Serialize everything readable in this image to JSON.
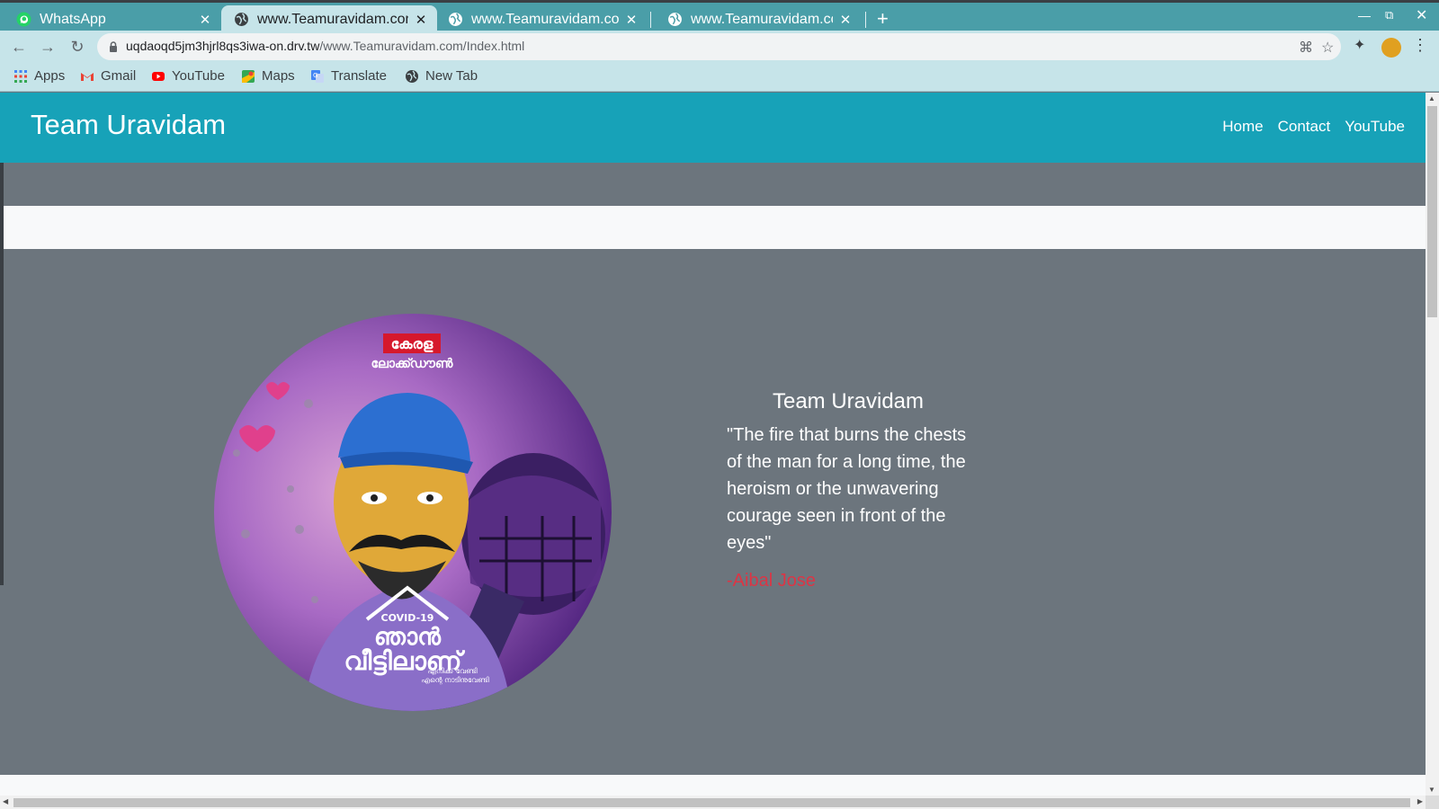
{
  "browser": {
    "tabs": [
      {
        "title": "WhatsApp",
        "icon": "whatsapp-icon",
        "active": false
      },
      {
        "title": "www.Teamuravidam.com",
        "icon": "globe-icon",
        "active": true
      },
      {
        "title": "www.Teamuravidam.com",
        "icon": "globe-icon",
        "active": false
      },
      {
        "title": "www.Teamuravidam.com",
        "icon": "globe-icon",
        "active": false
      }
    ],
    "url_host": "uqdaoqd5jm3hjrl8qs3iwa-on.drv.tw",
    "url_path": "/www.Teamuravidam.com/Index.html",
    "bookmarks": [
      {
        "label": "Apps",
        "icon": "apps-grid-icon"
      },
      {
        "label": "Gmail",
        "icon": "gmail-icon"
      },
      {
        "label": "YouTube",
        "icon": "youtube-icon"
      },
      {
        "label": "Maps",
        "icon": "maps-icon"
      },
      {
        "label": "Translate",
        "icon": "translate-icon"
      },
      {
        "label": "New Tab",
        "icon": "globe-icon"
      }
    ]
  },
  "site": {
    "brand": "Team Uravidam",
    "nav": [
      "Home",
      "Contact",
      "YouTube"
    ],
    "colors": {
      "navbar": "#17a2b8",
      "body": "#6c757d",
      "author": "#dc3545"
    }
  },
  "hero": {
    "image_text_top_1": "കേരള",
    "image_text_top_2": "ലോക്ക്ഡൗൺ",
    "image_text_covid": "COVID-19",
    "image_text_main_1": "ഞാൻ",
    "image_text_main_2": "വീട്ടിലാണ്",
    "image_text_sub_1": "എനിക്ക് വേണ്ടി",
    "image_text_sub_2": "എന്റെ നാടിനുവേണ്ടി",
    "quote_title": "Team Uravidam",
    "quote": "\"The fire that burns the chests of the man for a long time, the heroism or the unwavering courage seen in front of the eyes\"",
    "author": "-Aibal Jose"
  }
}
